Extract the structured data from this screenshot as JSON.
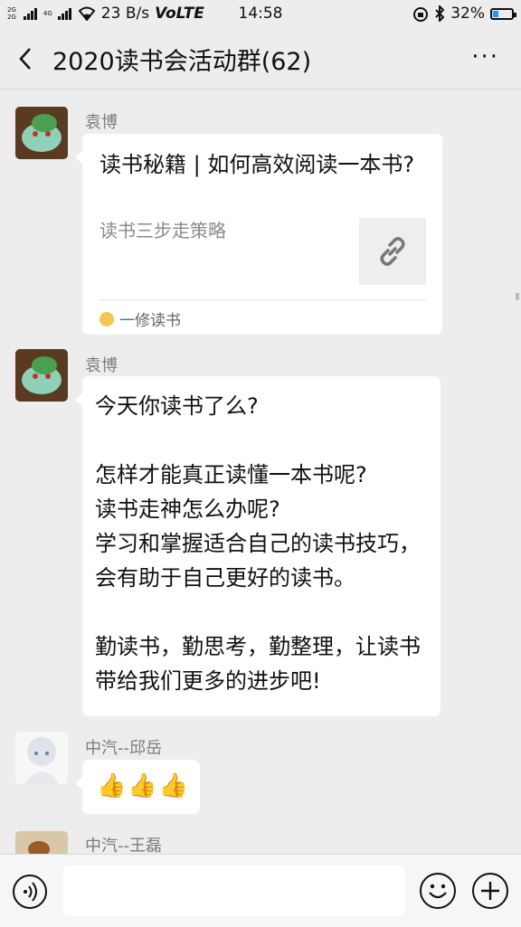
{
  "status_bar": {
    "network_top": "2G",
    "network_mid": "4G",
    "network_bot": "2G",
    "speed": "23 B/s",
    "volte": "VoLTE",
    "time": "14:58",
    "battery": "32%",
    "battery_level": 0.32,
    "icons": [
      "wifi-icon",
      "alarm-icon",
      "bluetooth-icon",
      "battery-charging-icon"
    ]
  },
  "header": {
    "back_icon": "chevron-left-icon",
    "title": "2020读书会活动群(62)",
    "more_label": "···"
  },
  "messages": [
    {
      "sender": "袁博",
      "avatar": "pokemon-avatar",
      "type": "link",
      "link_title": "读书秘籍 | 如何高效阅读一本书?",
      "link_desc": "读书三步走策略",
      "link_icon": "link-icon",
      "source": "一修读书"
    },
    {
      "sender": "袁博",
      "avatar": "pokemon-avatar",
      "type": "text",
      "text": "今天你读书了么?\n\n怎样才能真正读懂一本书呢?\n读书走神怎么办呢?\n学习和掌握适合自己的读书技巧，会有助于自己更好的读书。\n\n勤读书，勤思考，勤整理，让读书带给我们更多的进步吧!"
    },
    {
      "sender": "中汽--邱岳",
      "avatar": "anime-avatar",
      "type": "emoji",
      "text": "👍👍👍"
    },
    {
      "sender": "中汽--王磊",
      "avatar": "dog-avatar",
      "type": "partial"
    }
  ],
  "input_bar": {
    "voice_icon": "voice-icon",
    "placeholder": "",
    "emoji_icon": "emoji-icon",
    "plus_icon": "plus-icon"
  },
  "colors": {
    "background": "#ededed",
    "bubble": "#ffffff",
    "name_gray": "#7d7d7d"
  }
}
